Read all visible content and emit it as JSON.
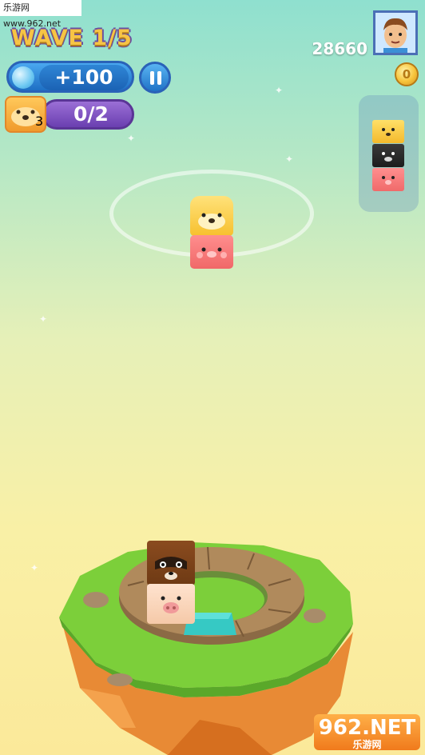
{
  "watermark_top": "乐游网 www.962.net",
  "hud": {
    "wave_label": "WAVE 1/5",
    "bonus_value": "+100",
    "goal_progress": "0/2",
    "goal_badge_count": "3",
    "high_score": "28660",
    "coins": "0"
  },
  "queue": {
    "items": [
      "yellow-dog-block",
      "black-cat-block",
      "pink-pig-block"
    ]
  },
  "falling_stack": {
    "blocks": [
      "yellow-dog-block",
      "pink-pig-block"
    ]
  },
  "island_stack": {
    "blocks": [
      "raccoon-block",
      "pig-block"
    ]
  },
  "watermark_bottom": {
    "big": "962.NET",
    "small": "乐游网"
  },
  "colors": {
    "wave_text": "#f6c445",
    "bonus_pill": "#1e6fc4",
    "goal_pill": "#6a3fb0",
    "grass": "#7ccf3a",
    "rock": "#e88a35",
    "wood": "#8b6a45",
    "target_slot": "#36c9c4"
  }
}
